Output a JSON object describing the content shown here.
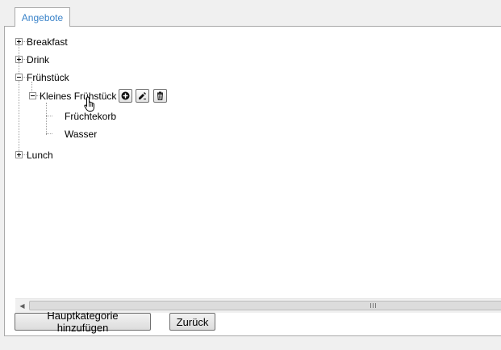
{
  "tabs": [
    {
      "label": "Angebote",
      "active": true
    }
  ],
  "tree": {
    "items": [
      {
        "label": "Breakfast",
        "expanded": false
      },
      {
        "label": "Drink",
        "expanded": false
      },
      {
        "label": "Frühstück",
        "expanded": true,
        "children": [
          {
            "label": "Kleines Frühstück",
            "expanded": true,
            "children": [
              {
                "label": "Früchtekorb"
              },
              {
                "label": "Wasser"
              }
            ]
          }
        ]
      },
      {
        "label": "Lunch",
        "expanded": false
      }
    ],
    "row_actions": [
      "add-icon",
      "edit-icon",
      "delete-icon"
    ]
  },
  "buttons": {
    "add_main_category": "Hauptkategorie hinzufügen",
    "back": "Zurück"
  },
  "colors": {
    "tab_text": "#3a83c9",
    "border": "#a9a9a9",
    "background": "#f0f0f0"
  }
}
